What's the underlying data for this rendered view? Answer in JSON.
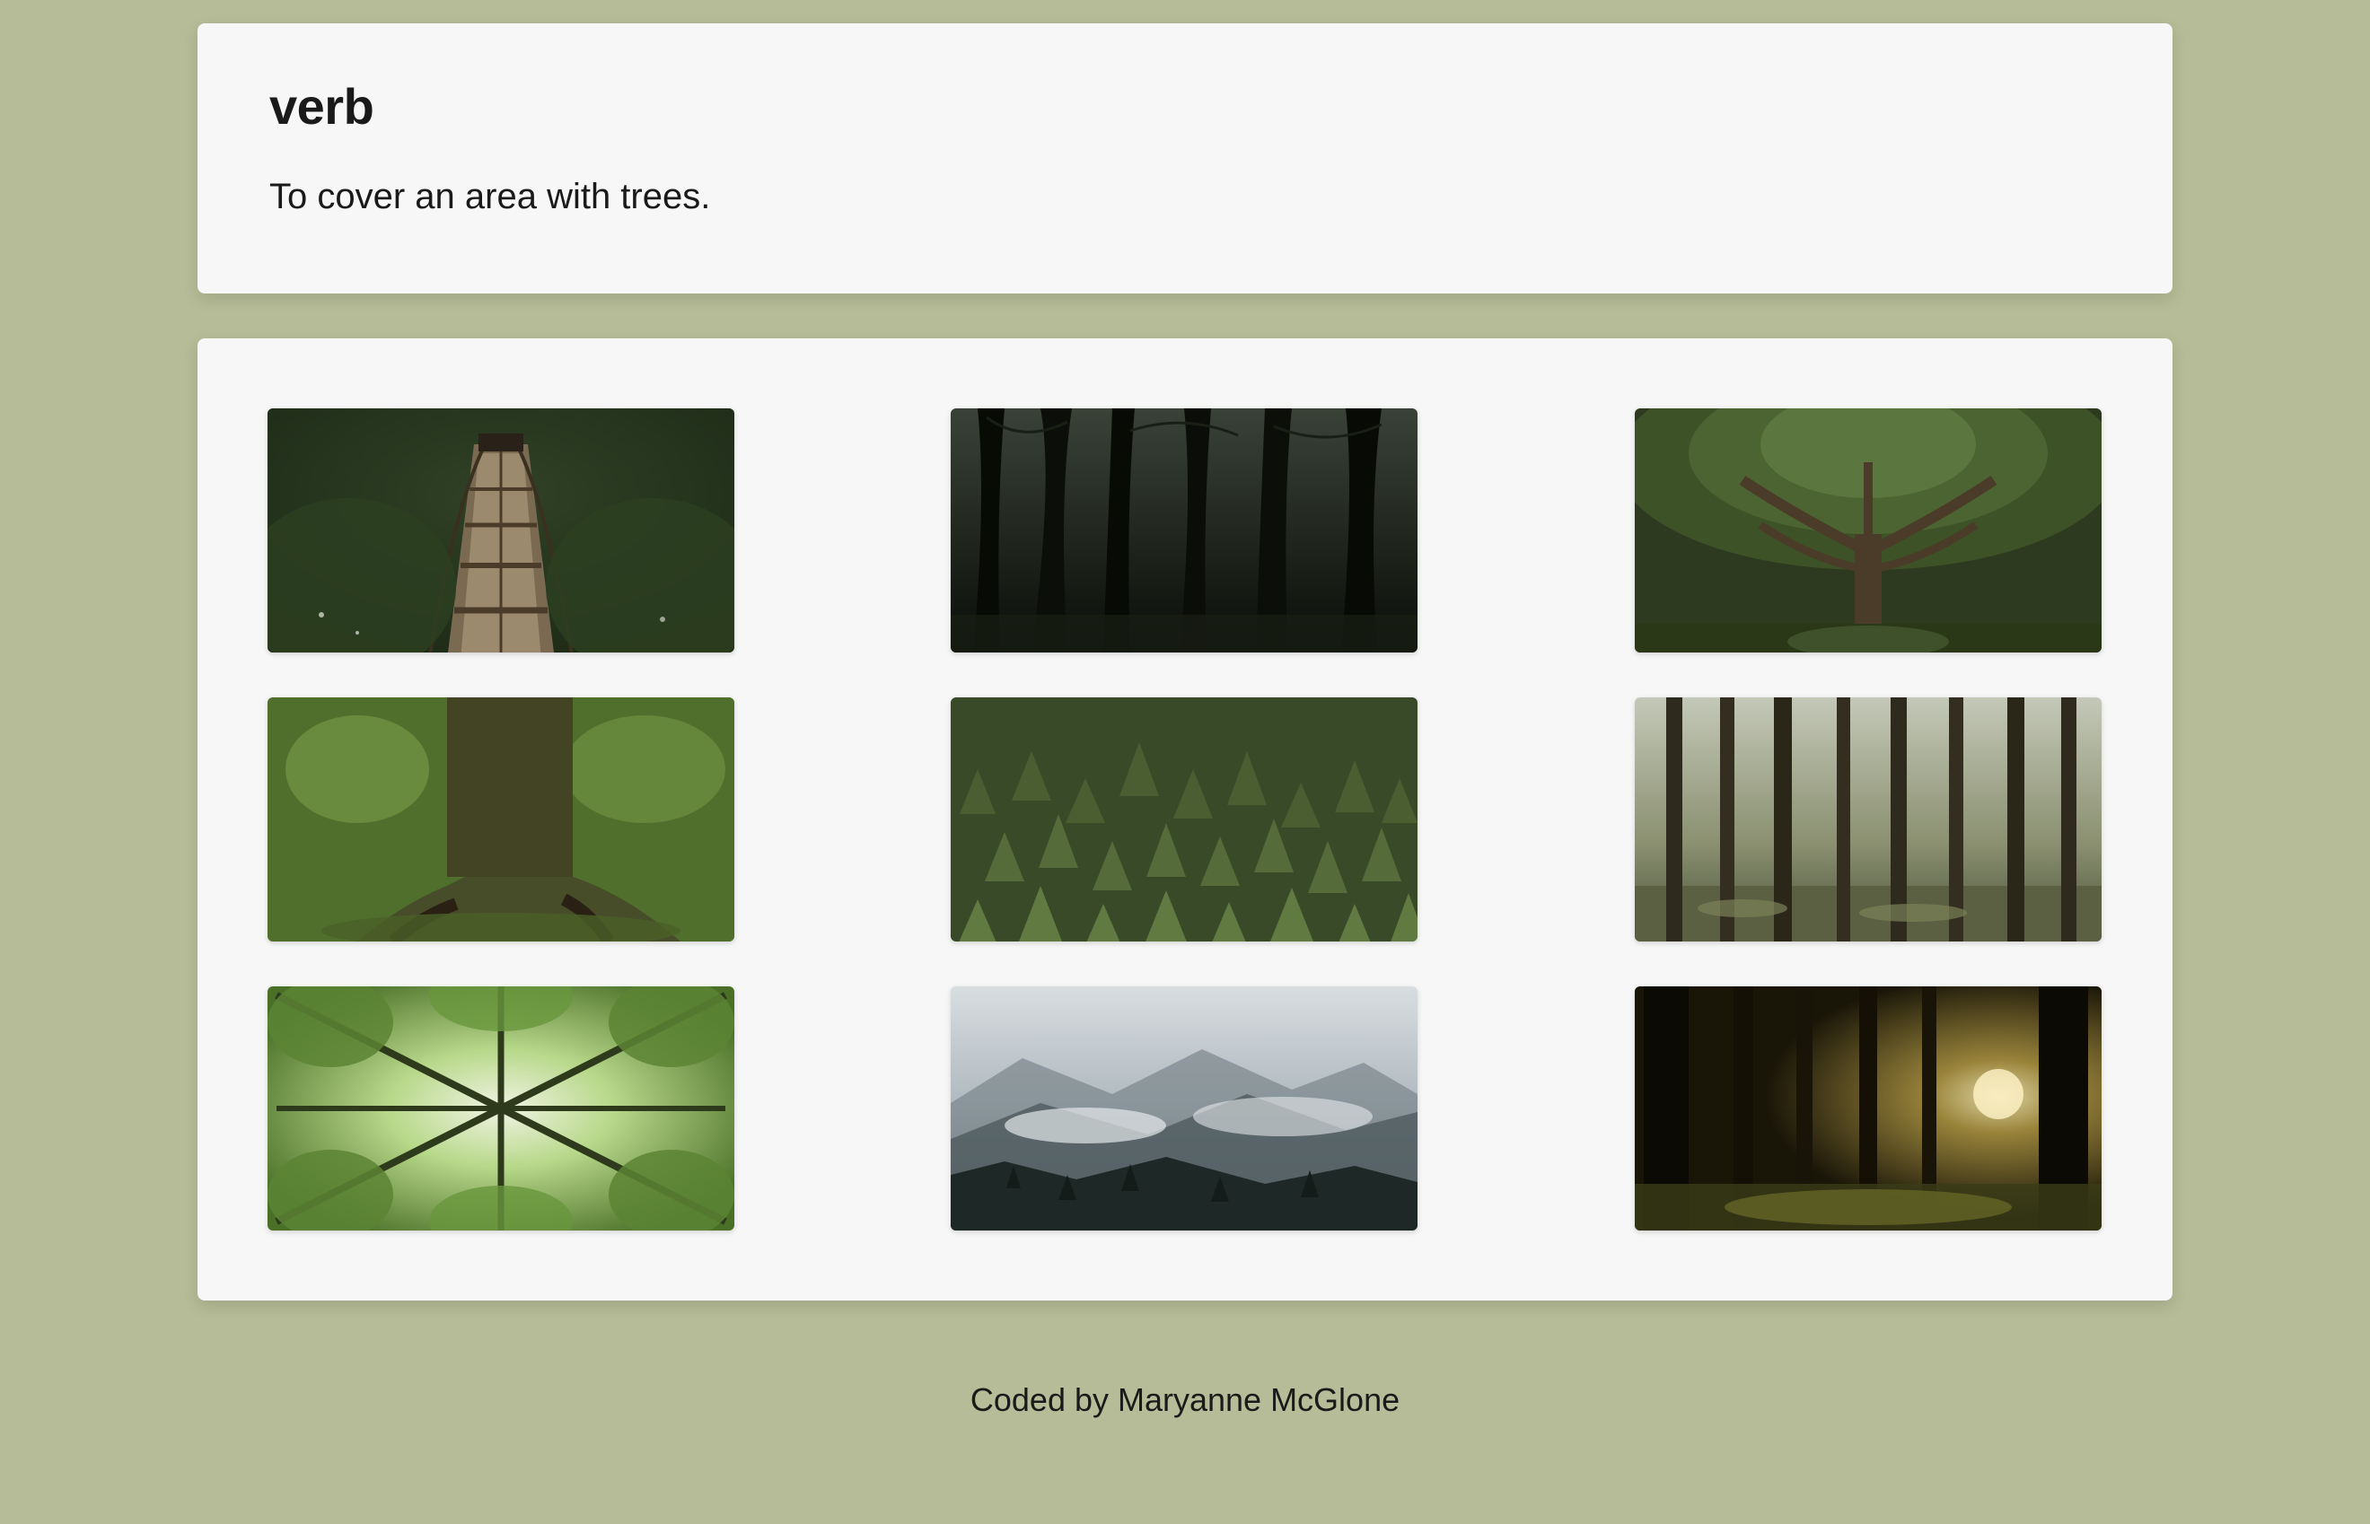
{
  "definition": {
    "part_of_speech": "verb",
    "text": "To cover an area with trees."
  },
  "gallery": {
    "images": [
      {
        "name": "forest-bridge"
      },
      {
        "name": "dark-forest"
      },
      {
        "name": "large-tree"
      },
      {
        "name": "mossy-trunk"
      },
      {
        "name": "pine-tops"
      },
      {
        "name": "tall-pines"
      },
      {
        "name": "canopy-view"
      },
      {
        "name": "misty-mountains"
      },
      {
        "name": "sunlit-forest"
      }
    ]
  },
  "footer": {
    "credit": "Coded by Maryanne McGlone"
  }
}
